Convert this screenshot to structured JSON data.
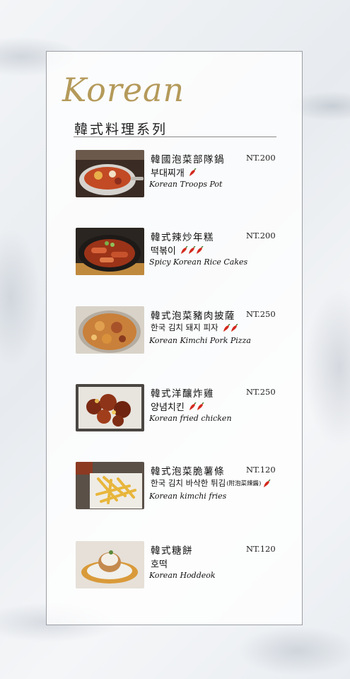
{
  "header": {
    "logo_text": "Korean",
    "subtitle": "韓式料理系列"
  },
  "colors": {
    "gold": "#b49a5a",
    "chili_red": "#d32a1e"
  },
  "items": [
    {
      "name_zh": "韓國泡菜部隊鍋",
      "name_ko": "부대찌개",
      "name_en": "Korean Troops Pot",
      "price": "NT.200",
      "spice": 1,
      "note": ""
    },
    {
      "name_zh": "韓式辣炒年糕",
      "name_ko": "떡볶이",
      "name_en": "Spicy Korean Rice Cakes",
      "price": "NT.200",
      "spice": 3,
      "note": ""
    },
    {
      "name_zh": "韓式泡菜豬肉披薩",
      "name_ko": "한국 김치 돼지 피자",
      "name_en": "Korean Kimchi Pork Pizza",
      "price": "NT.250",
      "spice": 2,
      "note": ""
    },
    {
      "name_zh": "韓式洋釀炸雞",
      "name_ko": "양념치킨",
      "name_en": "Korean fried chicken",
      "price": "NT.250",
      "spice": 2,
      "note": ""
    },
    {
      "name_zh": "韓式泡菜脆薯條",
      "name_ko": "한국 김치 바삭한 튀김",
      "name_en": "Korean kimchi fries",
      "price": "NT.120",
      "spice": 1,
      "note": "(附泡菜辣醬)"
    },
    {
      "name_zh": "韓式糖餅",
      "name_ko": "호떡",
      "name_en": "Korean Hoddeok",
      "price": "NT.120",
      "spice": 0,
      "note": ""
    }
  ]
}
